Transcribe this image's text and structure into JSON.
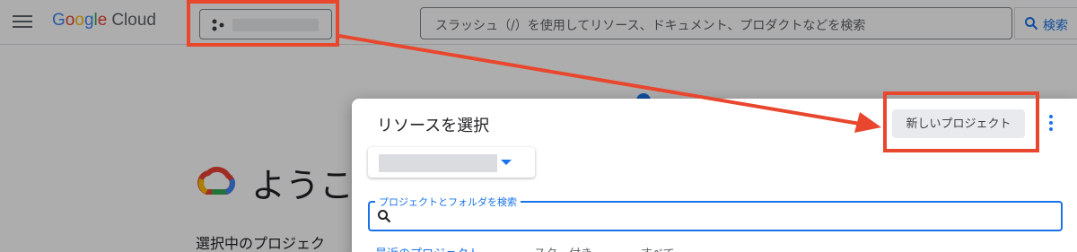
{
  "header": {
    "logo_text": "Google Cloud",
    "search_placeholder": "スラッシュ（/）を使用してリソース、ドキュメント、プロダクトなどを検索",
    "search_button_label": "検索"
  },
  "background": {
    "welcome_title": "ようこ",
    "selected_project_text": "選択中のプロジェク"
  },
  "dialog": {
    "title": "リソースを選択",
    "new_project_button": "新しいプロジェクト",
    "filter_label": "プロジェクトとフォルダを検索",
    "tabs": [
      {
        "label": "最近のプロジェクト"
      },
      {
        "label": "スター付き"
      },
      {
        "label": "すべて"
      }
    ]
  },
  "colors": {
    "accent": "#1a73e8",
    "callout": "#e8472e"
  },
  "icons": [
    "menu-icon",
    "project-icon",
    "search-icon",
    "google-cloud-logo-icon",
    "dropdown-arrow-icon",
    "more-vert-icon"
  ]
}
